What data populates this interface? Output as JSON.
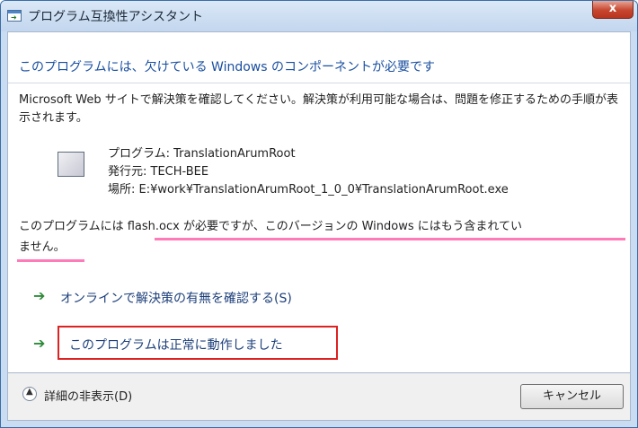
{
  "window": {
    "title": "プログラム互換性アシスタント",
    "close_label": "x"
  },
  "main": {
    "header": "このプログラムには、欠けている Windows のコンポーネントが必要です",
    "description": "Microsoft Web サイトで解決策を確認してください。解決策が利用可能な場合は、問題を修正するための手順が表示されます。",
    "program_info": [
      "プログラム: TranslationArumRoot",
      "発行元: TECH-BEE",
      "場所: E:¥work¥TranslationArumRoot_1_0_0¥TranslationArumRoot.exe"
    ],
    "requirement_line1": "このプログラムには flash.ocx が必要ですが、このバージョンの Windows にはもう含まれてい",
    "requirement_line2": "ません。",
    "commands": [
      {
        "label": "オンラインで解決策の有無を確認する(S)"
      },
      {
        "label": "このプログラムは正常に動作しました"
      }
    ]
  },
  "footer": {
    "details_toggle": "詳細の非表示(D)",
    "cancel_label": "キャンセル"
  },
  "colors": {
    "highlight_box": "#dd2222",
    "underline": "#ff7ab8",
    "header_text": "#1a4fa0",
    "arrow": "#2e8b3a"
  },
  "icons": [
    "app-small-icon",
    "program-icon",
    "green-arrow-icon",
    "chevron-up-circle-icon",
    "close-icon"
  ]
}
